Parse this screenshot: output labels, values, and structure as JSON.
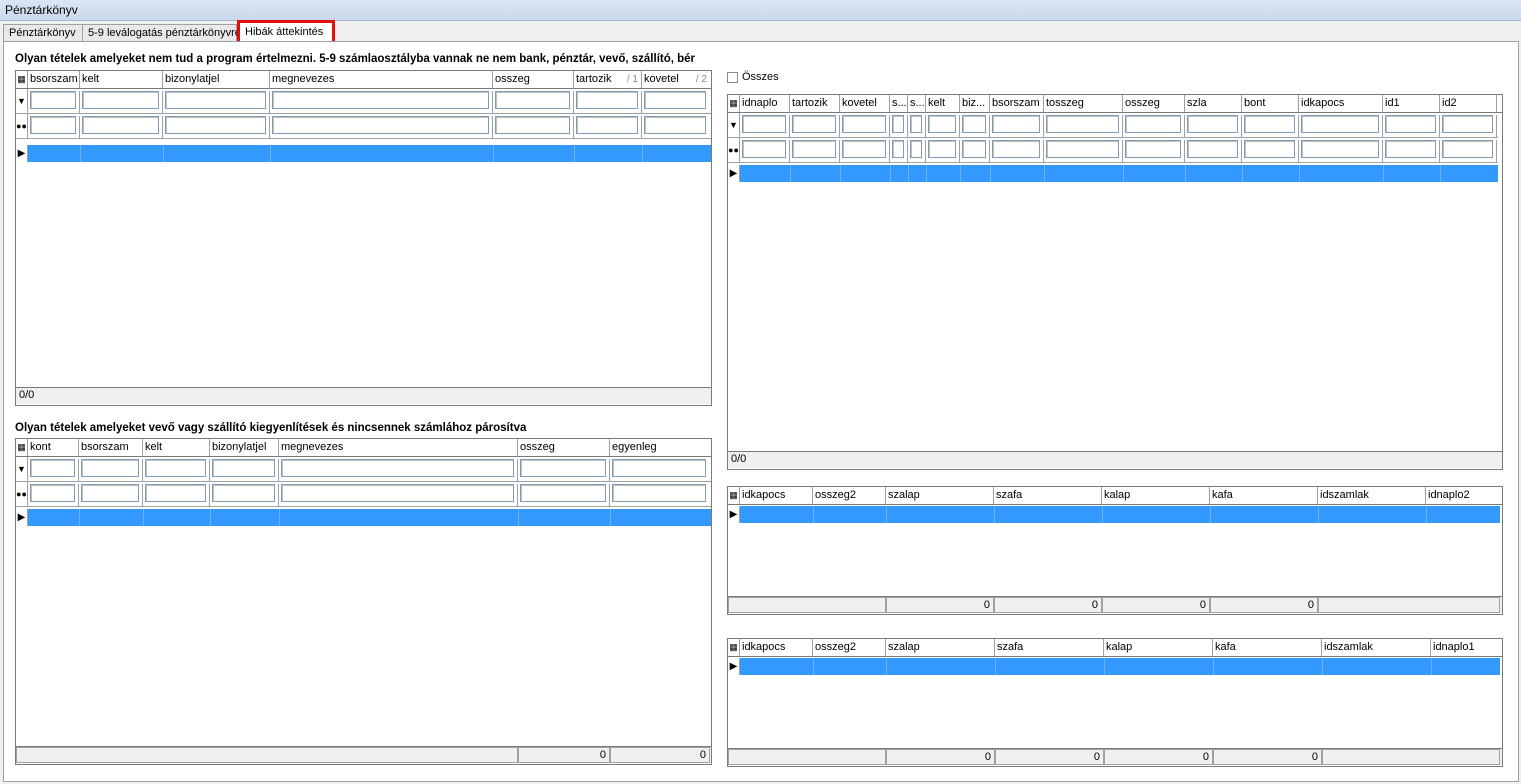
{
  "window": {
    "title": "Pénztárkönyv"
  },
  "tabs": [
    {
      "label": "Pénztárkönyv"
    },
    {
      "label": "5-9 leválogatás pénztárkönyvre"
    },
    {
      "label": "Hibák áttekintés"
    }
  ],
  "section1": {
    "title": "Olyan tételek amelyeket nem tud a program értelmezni. 5-9 számlaosztályba vannak ne nem bank, pénztár, vevő, szállító, bér",
    "columns": [
      "bsorszam",
      "kelt",
      "bizonylatjel",
      "megnevezes",
      "osszeg",
      "tartozik",
      "kovetel"
    ],
    "sort_marks": {
      "tartozik": "/ 1",
      "kovetel": "/ 2"
    },
    "footer": "0/0"
  },
  "section2": {
    "title": "Olyan tételek amelyeket vevő vagy szállító kiegyenlítések és nincsennek számlához párosítva",
    "columns": [
      "kont",
      "bsorszam",
      "kelt",
      "bizonylatjel",
      "megnevezes",
      "osszeg",
      "egyenleg"
    ],
    "footer_values": [
      "0",
      "0"
    ]
  },
  "right_top": {
    "checkbox_label": "Összes",
    "columns": [
      "idnaplo",
      "tartozik",
      "kovetel",
      "s...",
      "s...",
      "kelt",
      "biz...",
      "bsorszam",
      "tosszeg",
      "osszeg",
      "szla",
      "bont",
      "idkapocs",
      "id1",
      "id2"
    ],
    "footer": "0/0"
  },
  "right_mid": {
    "columns": [
      "idkapocs",
      "osszeg2",
      "szalap",
      "szafa",
      "kalap",
      "kafa",
      "idszamlak",
      "idnaplo2"
    ],
    "footer_values": [
      "0",
      "0",
      "0",
      "0"
    ]
  },
  "right_bottom": {
    "columns": [
      "idkapocs",
      "osszeg2",
      "szalap",
      "szafa",
      "kalap",
      "kafa",
      "idszamlak",
      "idnaplo1"
    ],
    "footer_values": [
      "0",
      "0",
      "0",
      "0"
    ]
  },
  "icons": {
    "filter_row": "filter-icon",
    "search_row": "binoculars-icon",
    "column_chooser": "column-chooser-icon",
    "current_row": "row-pointer-icon"
  },
  "colors": {
    "selection": "#3399ff",
    "highlight": "#e01010"
  }
}
